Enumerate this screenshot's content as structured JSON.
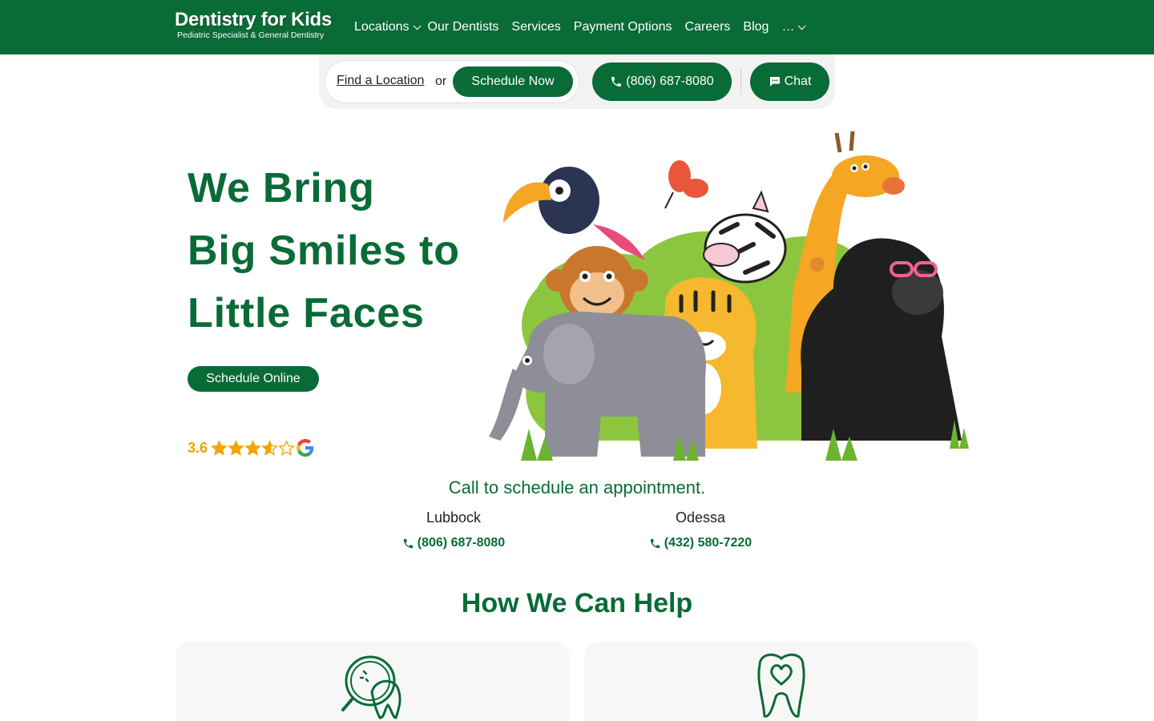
{
  "header": {
    "logo_title": "Dentistry for Kids",
    "logo_subtitle": "Pediatric Specialist & General Dentistry",
    "nav": [
      {
        "label": "Locations",
        "dropdown": true
      },
      {
        "label": "Our Dentists",
        "dropdown": false
      },
      {
        "label": "Services",
        "dropdown": false
      },
      {
        "label": "Payment Options",
        "dropdown": false
      },
      {
        "label": "Careers",
        "dropdown": false
      },
      {
        "label": "Blog",
        "dropdown": false
      },
      {
        "label": "…",
        "dropdown": true
      }
    ]
  },
  "actions": {
    "find_location": "Find a Location",
    "or_text": "or",
    "schedule_now": "Schedule Now",
    "phone": "(806) 687-8080",
    "chat": "Chat"
  },
  "hero": {
    "title_lines": [
      "We Bring",
      "Big Smiles to",
      "Little Faces"
    ],
    "cta": "Schedule Online",
    "rating_value": "3.6",
    "rating_stars": 3.6,
    "rating_max": 5,
    "rating_source_icon": "google-icon",
    "illustration": "jungle-animals-illustration"
  },
  "call": {
    "title": "Call to schedule an appointment.",
    "locations": [
      {
        "name": "Lubbock",
        "phone": "(806) 687-8080"
      },
      {
        "name": "Odessa",
        "phone": "(432) 580-7220"
      }
    ]
  },
  "help": {
    "title": "How We Can Help",
    "cards": [
      {
        "icon": "tooth-magnifier-icon"
      },
      {
        "icon": "tooth-heart-icon"
      }
    ]
  },
  "colors": {
    "brand_green": "#096b36",
    "star_gold": "#f0a500",
    "card_bg": "#f7f7f7"
  }
}
